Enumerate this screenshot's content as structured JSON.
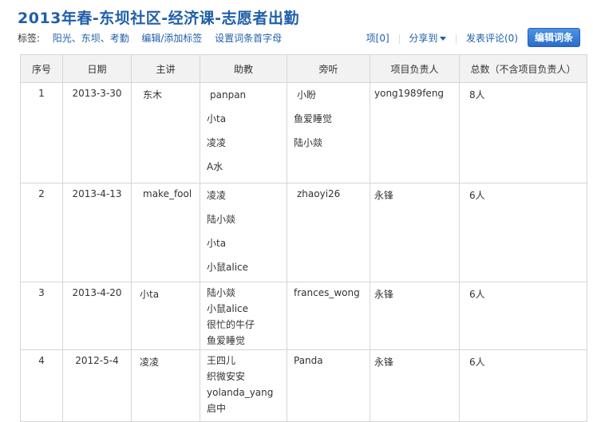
{
  "header": {
    "title": "2013年春-东坝社区-经济课-志愿者出勤"
  },
  "tags": {
    "label": "标签:",
    "items": "阳光、东坝、考勤",
    "edit_link": "编辑/添加标签",
    "index_link": "设置词条首字母"
  },
  "toolbar": {
    "item_link": "项[0]",
    "share_link": "分享到",
    "comment_link": "发表评论(0)",
    "edit_button": "编辑词条"
  },
  "table": {
    "columns": [
      "序号",
      "日期",
      "主讲",
      "助教",
      "旁听",
      "项目负责人",
      "总数（不含项目负责人）"
    ],
    "rows": [
      {
        "no": "1",
        "date": "2013-3-30",
        "speaker": "东木",
        "assistants": [
          "panpan",
          "小ta",
          "凌凌",
          "A水"
        ],
        "auditors": [
          "小盼",
          "鱼爱睡觉",
          "陆小燚"
        ],
        "lead": "yong1989feng",
        "total": "8人"
      },
      {
        "no": "2",
        "date": "2013-4-13",
        "speaker": "make_fool",
        "assistants": [
          "凌凌",
          "陆小燚",
          "小ta",
          "小鼠alice"
        ],
        "auditors": [
          "zhaoyi26"
        ],
        "lead": "永锋",
        "total": "6人"
      },
      {
        "no": "3",
        "date": "2013-4-20",
        "speaker": "小ta",
        "assistants": [
          "陆小燚",
          "小鼠alice",
          "很忙的牛仔",
          "鱼爱睡觉"
        ],
        "auditors": [
          "frances_wong"
        ],
        "lead": "永锋",
        "total": "6人"
      },
      {
        "no": "4",
        "date": "2012-5-4",
        "speaker": "凌凌",
        "assistants": [
          "王四儿",
          "织微安安",
          "yolanda_yang",
          "启中"
        ],
        "auditors": [
          "Panda"
        ],
        "lead": "永锋",
        "total": "6人"
      }
    ]
  },
  "colors": {
    "title": "#1f5faa",
    "link": "#1f5faa",
    "button": "#2a6dc7",
    "header_bg": "#f2f2f2",
    "border": "#d6d6d6"
  }
}
